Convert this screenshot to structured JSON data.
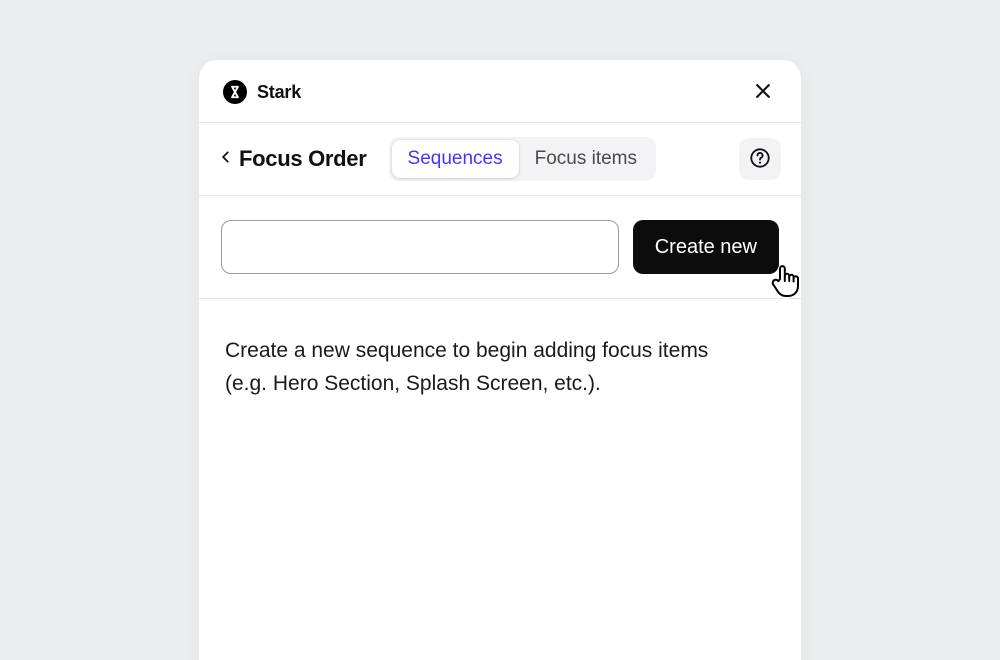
{
  "header": {
    "brand": "Stark"
  },
  "toolbar": {
    "title": "Focus Order",
    "tabs": {
      "sequences": "Sequences",
      "focus_items": "Focus items"
    }
  },
  "create": {
    "input_value": "",
    "button_label": "Create new"
  },
  "body": {
    "hint": "Create a new sequence to begin adding focus items (e.g. Hero Section, Splash Screen, etc.)."
  },
  "colors": {
    "accent": "#4733ff",
    "panel_bg": "#ffffff",
    "page_bg": "#ebedef"
  }
}
